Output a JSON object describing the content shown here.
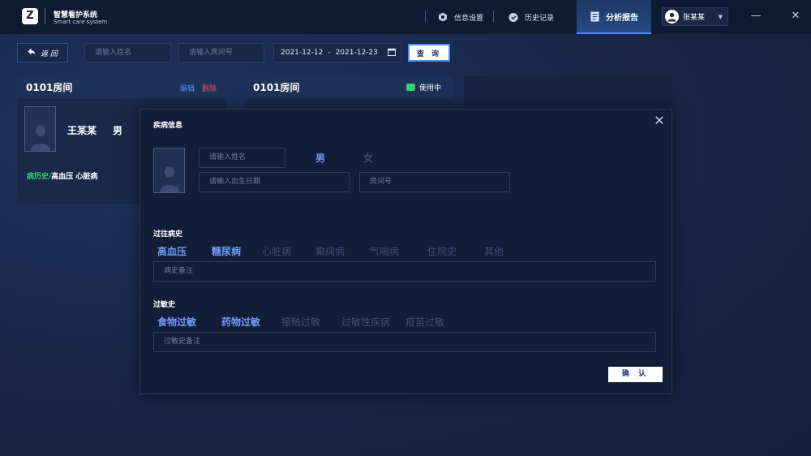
{
  "app": {
    "logo_letter": "Z",
    "title": "智慧看护系统",
    "subtitle": "Smart care system"
  },
  "nav": {
    "info_settings": "信息设置",
    "history": "历史记录",
    "analysis_report": "分析报告"
  },
  "user": {
    "name": "张某某"
  },
  "window": {
    "minimize": "—",
    "close": "✕"
  },
  "filter": {
    "back_label": "返 回",
    "name_placeholder": "请输入姓名",
    "room_placeholder": "请输入房间号",
    "date_start": "2021-12-12",
    "date_sep": "-",
    "date_end": "2021-12-23",
    "query_label": "查 询"
  },
  "cards": [
    {
      "room": "0101房间",
      "edit": "编辑",
      "delete": "删除",
      "name": "王某某",
      "gender": "男",
      "history_label": "病历史/",
      "history_value": "高血压 心脏病"
    },
    {
      "room": "0101房间",
      "status": "使用中"
    }
  ],
  "modal": {
    "title": "疾病信息",
    "close": "✕",
    "name_placeholder": "请输入姓名",
    "gender_male": "男",
    "gender_female": "女",
    "selected_gender": "男",
    "birth_placeholder": "请输入出生日期",
    "room_placeholder": "房间号",
    "past_history_title": "过往病史",
    "past_history_tags": [
      {
        "label": "高血压",
        "selected": true
      },
      {
        "label": "糖尿病",
        "selected": true
      },
      {
        "label": "心脏病",
        "selected": false
      },
      {
        "label": "癫痫病",
        "selected": false
      },
      {
        "label": "气喘病",
        "selected": false
      },
      {
        "label": "住院史",
        "selected": false
      },
      {
        "label": "其他",
        "selected": false
      }
    ],
    "history_note_placeholder": "病史备注",
    "allergy_title": "过敏史",
    "allergy_tags": [
      {
        "label": "食物过敏",
        "selected": true
      },
      {
        "label": "药物过敏",
        "selected": true
      },
      {
        "label": "接触过敏",
        "selected": false
      },
      {
        "label": "过敏性疾病",
        "selected": false
      },
      {
        "label": "疫苗过敏",
        "selected": false
      }
    ],
    "allergy_note_placeholder": "过敏史备注",
    "confirm": "确 认"
  },
  "colors": {
    "accent": "#4f8ef7",
    "selected_tag": "#6f9bf7",
    "unselected_tag": "#3f4e72",
    "status_green": "#31d36e",
    "delete_red": "#f0524f"
  }
}
